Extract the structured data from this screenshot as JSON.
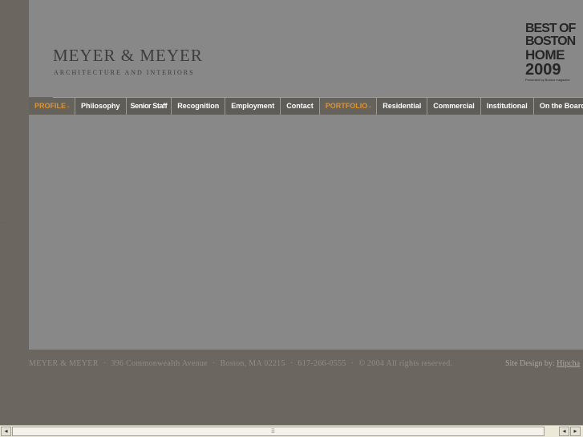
{
  "colors": {
    "page_background": "#6b6760",
    "header_background": "#888888",
    "nav_background": "#5f5d58",
    "nav_section_accent": "#e0932e",
    "logo_text": "#3d3d3d"
  },
  "logo": {
    "name": "MEYER & MEYER",
    "tagline": "ARCHITECTURE AND INTERIORS"
  },
  "award": {
    "line1": "BEST OF",
    "line2": "BOSTON",
    "line3": "HOME",
    "line4": "2009",
    "line5": "Presented by Boston magazine"
  },
  "nav": {
    "arrow_glyph": "›",
    "items": [
      {
        "label": "PROFILE",
        "section": true
      },
      {
        "label": "Philosophy"
      },
      {
        "label": "Senior Staff"
      },
      {
        "label": "Recognition"
      },
      {
        "label": "Employment"
      },
      {
        "label": "Contact"
      },
      {
        "label": "PORTFOLIO",
        "section": true
      },
      {
        "label": "Residential"
      },
      {
        "label": "Commercial"
      },
      {
        "label": "Institutional"
      },
      {
        "label": "On the Boards"
      }
    ]
  },
  "footer": {
    "company": "MEYER & MEYER",
    "address": "396 Commonwealth Avenue",
    "city": "Boston, MA 02215",
    "phone": "617-266-0555",
    "copyright": "© 2004 All rights reserved.",
    "separator": "·",
    "site_design_label": "Site Design by:",
    "site_design_link": "Hipcha"
  },
  "scrollbar": {
    "left_arrow": "◂",
    "right_arrow": "▸",
    "grip": "⁞⁞⁞⁞"
  }
}
